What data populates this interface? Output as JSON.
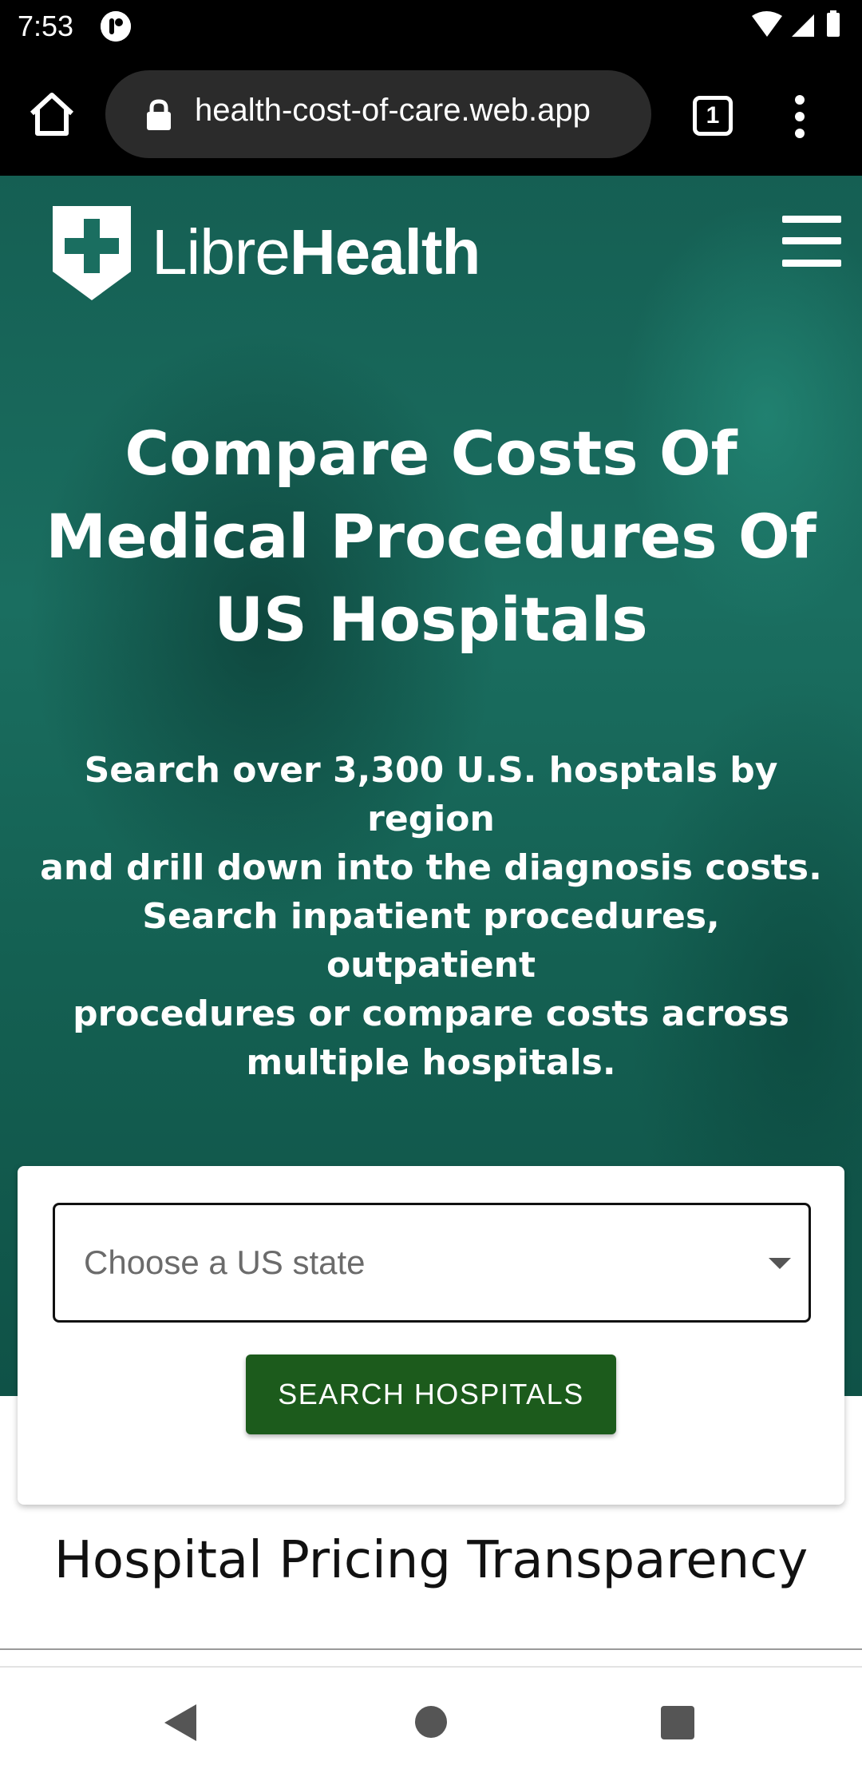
{
  "status_bar": {
    "time": "7:53",
    "icons": [
      "app-notification-icon",
      "wifi-icon",
      "signal-icon",
      "battery-icon"
    ]
  },
  "browser": {
    "url": "health-cost-of-care.web.app",
    "tab_count": "1",
    "icons": [
      "home-icon",
      "lock-icon",
      "tabs-icon",
      "more-vert-icon"
    ]
  },
  "header": {
    "logo_light": "Libre",
    "logo_bold": "Health",
    "icons": [
      "shield-cross-logo-icon",
      "hamburger-menu-icon"
    ]
  },
  "hero": {
    "title_lines": [
      "Compare Costs Of",
      "Medical Procedures Of",
      "US Hospitals"
    ],
    "subtitle_lines": [
      "Search over 3,300 U.S. hosptals by region",
      "and drill down into the diagnosis costs.",
      "Search inpatient procedures, outpatient",
      "procedures or compare costs across",
      "multiple hospitals."
    ]
  },
  "search": {
    "state_placeholder": "Choose a US state",
    "button_label": "SEARCH HOSPITALS"
  },
  "section": {
    "title": "Hospital Pricing Transparency"
  },
  "colors": {
    "hero_teal": "#1a6e60",
    "button_green": "#1c5b1c",
    "status_bar": "#000000"
  }
}
